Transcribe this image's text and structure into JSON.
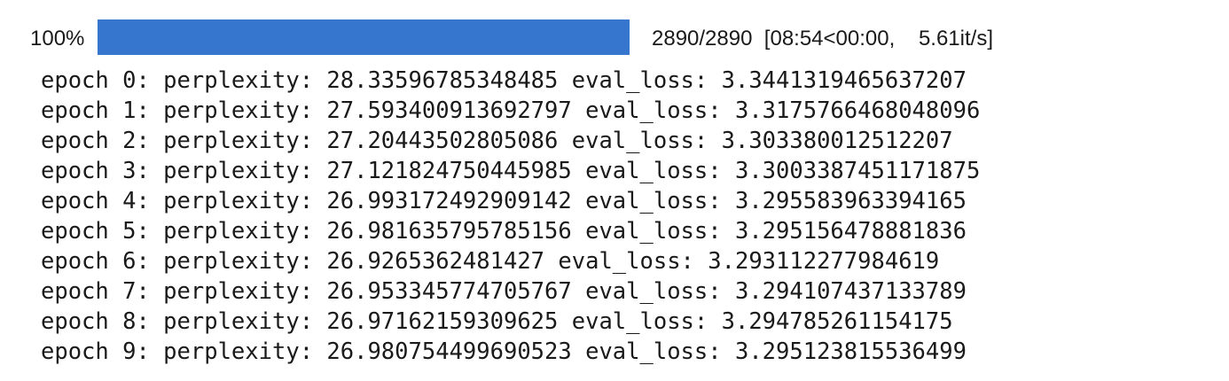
{
  "progress": {
    "percent_label": "100%",
    "fraction": 1.0,
    "bar_color": "#3776cf",
    "count": "2890/2890",
    "timing": "[08:54<00:00,",
    "rate": "5.61it/s]"
  },
  "log_lines": [
    "epoch 0: perplexity: 28.33596785348485 eval_loss: 3.3441319465637207",
    "epoch 1: perplexity: 27.593400913692797 eval_loss: 3.3175766468048096",
    "epoch 2: perplexity: 27.20443502805086 eval_loss: 3.303380012512207",
    "epoch 3: perplexity: 27.121824750445985 eval_loss: 3.3003387451171875",
    "epoch 4: perplexity: 26.993172492909142 eval_loss: 3.295583963394165",
    "epoch 5: perplexity: 26.981635795785156 eval_loss: 3.295156478881836",
    "epoch 6: perplexity: 26.9265362481427 eval_loss: 3.293112277984619",
    "epoch 7: perplexity: 26.953345774705767 eval_loss: 3.294107437133789",
    "epoch 8: perplexity: 26.97162159309625 eval_loss: 3.294785261154175",
    "epoch 9: perplexity: 26.980754499690523 eval_loss: 3.295123815536499"
  ]
}
